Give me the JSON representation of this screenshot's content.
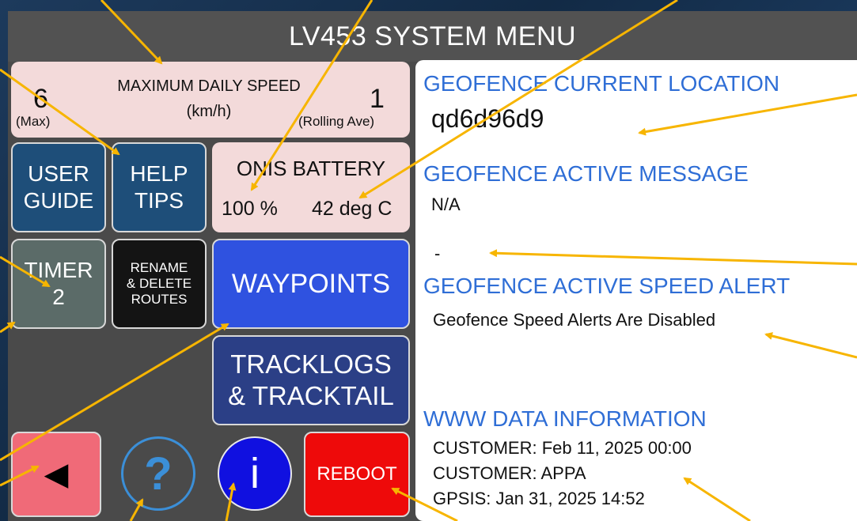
{
  "title": "LV453 SYSTEM MENU",
  "speed": {
    "header": "MAXIMUM DAILY SPEED",
    "unit": "(km/h)",
    "max_value": "6",
    "max_label": "(Max)",
    "rolling_value": "1",
    "rolling_label": "(Rolling Ave)"
  },
  "buttons": {
    "user_guide": [
      "USER",
      "GUIDE"
    ],
    "help_tips": [
      "HELP",
      "TIPS"
    ],
    "timer": [
      "TIMER",
      "2"
    ],
    "rename": [
      "RENAME",
      "& DELETE",
      "ROUTES"
    ],
    "waypoints": "WAYPOINTS",
    "tracklogs": [
      "TRACKLOGS",
      "& TRACKTAIL"
    ],
    "back_symbol": "◀",
    "help_symbol": "?",
    "info_symbol": "i",
    "reboot": "REBOOT"
  },
  "battery": {
    "header": "ONIS BATTERY",
    "percent": "100 %",
    "temperature": "42 deg C"
  },
  "geofence": {
    "location_header": "GEOFENCE CURRENT LOCATION",
    "location_value": "qd6d96d9",
    "message_header": "GEOFENCE ACTIVE MESSAGE",
    "message_value": "N/A",
    "message_extra": "-",
    "speed_alert_header": "GEOFENCE ACTIVE SPEED ALERT",
    "speed_alert_value": "Geofence Speed Alerts Are Disabled"
  },
  "www": {
    "header": "WWW DATA INFORMATION",
    "lines": [
      "CUSTOMER: Feb 11, 2025 00:00",
      "CUSTOMER: APPA",
      "GPSIS: Jan 31, 2025 14:52"
    ]
  },
  "colors": {
    "screen_bg": "#4a4a4a",
    "pink_panel": "#f3dada",
    "navy_button": "#1e4e79",
    "waypoints_blue": "#2f52e0",
    "tracklogs_navy": "#2b3f86",
    "reboot_red": "#ee0a0a",
    "back_pink": "#f06a78",
    "header_blue": "#2f6ed6",
    "annotation_arrow": "#f7b500"
  }
}
